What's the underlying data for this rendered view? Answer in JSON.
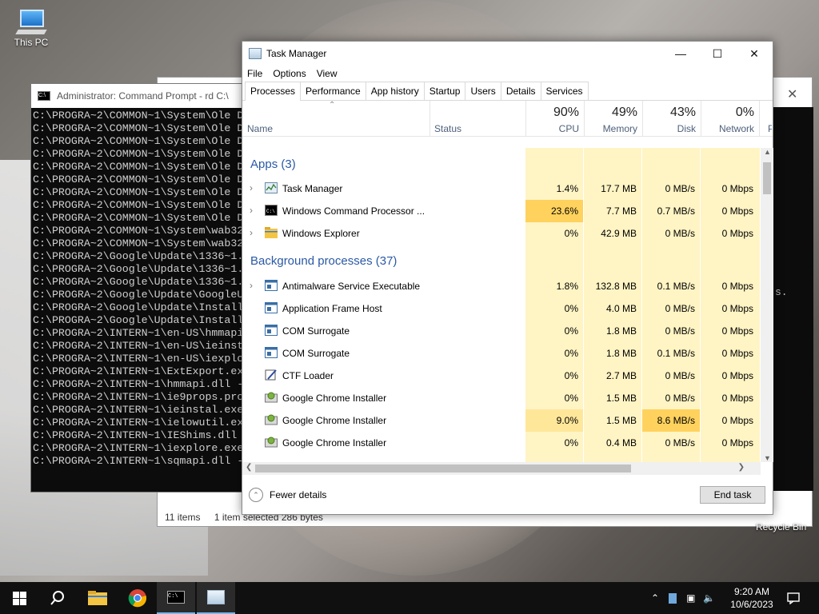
{
  "desktop": {
    "icons": [
      {
        "label": "This PC",
        "icon": "this-pc-icon"
      },
      {
        "label": "Recycle Bin",
        "icon": "recycle-bin-icon"
      }
    ]
  },
  "cmd": {
    "title": "Administrator: Command Prompt - rd  C:\\",
    "lines": [
      "C:\\PROGRA~2\\COMMON~1\\System\\Ole D",
      "C:\\PROGRA~2\\COMMON~1\\System\\Ole D",
      "C:\\PROGRA~2\\COMMON~1\\System\\Ole D",
      "C:\\PROGRA~2\\COMMON~1\\System\\Ole D",
      "C:\\PROGRA~2\\COMMON~1\\System\\Ole D",
      "C:\\PROGRA~2\\COMMON~1\\System\\Ole D",
      "C:\\PROGRA~2\\COMMON~1\\System\\Ole D",
      "C:\\PROGRA~2\\COMMON~1\\System\\Ole D",
      "C:\\PROGRA~2\\COMMON~1\\System\\Ole D",
      "C:\\PROGRA~2\\COMMON~1\\System\\wab32",
      "C:\\PROGRA~2\\COMMON~1\\System\\wab32",
      "C:\\PROGRA~2\\Google\\Update\\1336~1.",
      "C:\\PROGRA~2\\Google\\Update\\1336~1.",
      "C:\\PROGRA~2\\Google\\Update\\1336~1.",
      "C:\\PROGRA~2\\Google\\Update\\GoogleU",
      "C:\\PROGRA~2\\Google\\Update\\Install",
      "C:\\PROGRA~2\\Google\\Update\\Install",
      "C:\\PROGRA~2\\INTERN~1\\en-US\\hmmapi",
      "C:\\PROGRA~2\\INTERN~1\\en-US\\ieinst",
      "C:\\PROGRA~2\\INTERN~1\\en-US\\iexplo",
      "C:\\PROGRA~2\\INTERN~1\\ExtExport.ex",
      "C:\\PROGRA~2\\INTERN~1\\hmmapi.dll -",
      "C:\\PROGRA~2\\INTERN~1\\ie9props.pro",
      "C:\\PROGRA~2\\INTERN~1\\ieinstal.exe",
      "C:\\PROGRA~2\\INTERN~1\\ielowutil.ex",
      "C:\\PROGRA~2\\INTERN~1\\IEShims.dll",
      "C:\\PROGRA~2\\INTERN~1\\iexplore.exe",
      "C:\\PROGRA~2\\INTERN~1\\sqmapi.dll -"
    ]
  },
  "explorer": {
    "items_count": "11 items",
    "selection": "1 item selected  286 bytes",
    "side_text": "s."
  },
  "taskmgr": {
    "title": "Task Manager",
    "menu": [
      "File",
      "Options",
      "View"
    ],
    "tabs": [
      "Processes",
      "Performance",
      "App history",
      "Startup",
      "Users",
      "Details",
      "Services"
    ],
    "active_tab": "Processes",
    "headers": {
      "name": "Name",
      "status": "Status",
      "cpu": {
        "pct": "90%",
        "label": "CPU"
      },
      "memory": {
        "pct": "49%",
        "label": "Memory"
      },
      "disk": {
        "pct": "43%",
        "label": "Disk"
      },
      "network": {
        "pct": "0%",
        "label": "Network"
      },
      "power_cut": "P"
    },
    "groups": {
      "apps": "Apps (3)",
      "background": "Background processes (37)"
    },
    "apps": [
      {
        "name": "Task Manager",
        "icon": "task-manager-icon",
        "expand": true,
        "cpu": "1.4%",
        "memory": "17.7 MB",
        "disk": "0 MB/s",
        "network": "0 Mbps"
      },
      {
        "name": "Windows Command Processor ...",
        "icon": "cmd-icon",
        "expand": true,
        "cpu": "23.6%",
        "memory": "7.7 MB",
        "disk": "0.7 MB/s",
        "network": "0 Mbps"
      },
      {
        "name": "Windows Explorer",
        "icon": "folder-icon",
        "expand": true,
        "cpu": "0%",
        "memory": "42.9 MB",
        "disk": "0 MB/s",
        "network": "0 Mbps"
      }
    ],
    "background": [
      {
        "name": "Antimalware Service Executable",
        "icon": "service-icon",
        "expand": true,
        "cpu": "1.8%",
        "memory": "132.8 MB",
        "disk": "0.1 MB/s",
        "network": "0 Mbps"
      },
      {
        "name": "Application Frame Host",
        "icon": "service-icon",
        "expand": false,
        "cpu": "0%",
        "memory": "4.0 MB",
        "disk": "0 MB/s",
        "network": "0 Mbps"
      },
      {
        "name": "COM Surrogate",
        "icon": "service-icon",
        "expand": false,
        "cpu": "0%",
        "memory": "1.8 MB",
        "disk": "0 MB/s",
        "network": "0 Mbps"
      },
      {
        "name": "COM Surrogate",
        "icon": "service-icon",
        "expand": false,
        "cpu": "0%",
        "memory": "1.8 MB",
        "disk": "0.1 MB/s",
        "network": "0 Mbps"
      },
      {
        "name": "CTF Loader",
        "icon": "ctf-loader-icon",
        "expand": false,
        "cpu": "0%",
        "memory": "2.7 MB",
        "disk": "0 MB/s",
        "network": "0 Mbps"
      },
      {
        "name": "Google Chrome Installer",
        "icon": "installer-icon",
        "expand": false,
        "cpu": "0%",
        "memory": "1.5 MB",
        "disk": "0 MB/s",
        "network": "0 Mbps"
      },
      {
        "name": "Google Chrome Installer",
        "icon": "installer-icon",
        "expand": false,
        "cpu": "9.0%",
        "memory": "1.5 MB",
        "disk": "8.6 MB/s",
        "network": "0 Mbps"
      },
      {
        "name": "Google Chrome Installer",
        "icon": "installer-icon",
        "expand": false,
        "cpu": "0%",
        "memory": "0.4 MB",
        "disk": "0 MB/s",
        "network": "0 Mbps"
      }
    ],
    "fewer_details": "Fewer details",
    "end_task": "End task"
  },
  "taskbar": {
    "items": [
      "start-icon",
      "search-icon",
      "file-explorer-icon",
      "chrome-icon",
      "cmd-icon",
      "task-manager-icon"
    ],
    "time": "9:20 AM",
    "date": "10/6/2023"
  },
  "colors": {
    "heat_light": "#fff4c4",
    "heat_mid": "#ffe79a",
    "heat_high": "#ffd25e",
    "link": "#2a59a6"
  }
}
